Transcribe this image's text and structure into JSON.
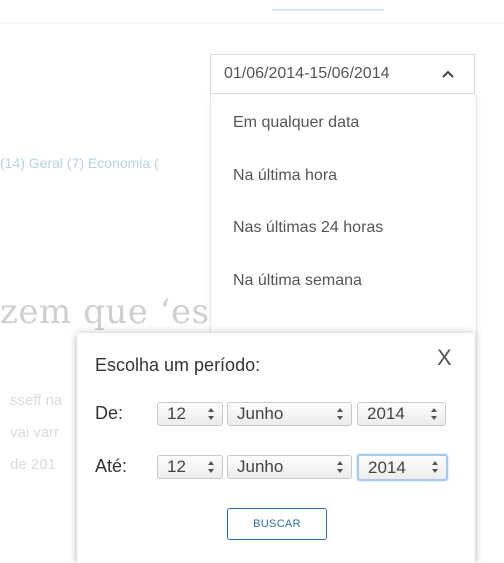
{
  "background": {
    "categories_text": "(14) Geral (7) Economia (",
    "headline_text": "zem que ‘esp",
    "snippet_lines": [
      "sseff na",
      "vai varr",
      "de 201"
    ]
  },
  "date_filter": {
    "selected_value": "01/06/2014-15/06/2014",
    "options": [
      "Em qualquer data",
      "Na última hora",
      "Nas últimas 24 horas",
      "Na última semana"
    ]
  },
  "period_modal": {
    "title": "Escolha um período:",
    "close_label": "X",
    "from_label": "De:",
    "to_label": "Até:",
    "from": {
      "day": "12",
      "month": "Junho",
      "year": "2014"
    },
    "to": {
      "day": "12",
      "month": "Junho",
      "year": "2014"
    },
    "search_button": "BUSCAR"
  },
  "colors": {
    "accent": "#2f6fa3",
    "focus_ring": "#a9c8ea"
  }
}
